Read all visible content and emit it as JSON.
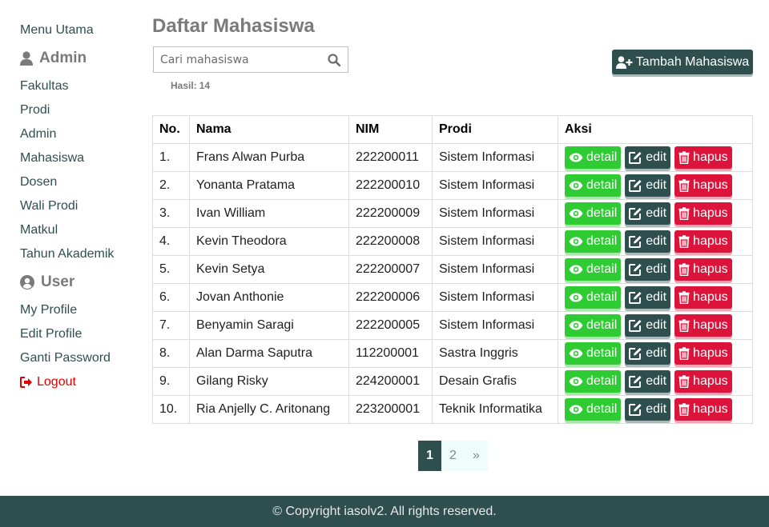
{
  "sidebar": {
    "menu_utama": "Menu Utama",
    "admin_section": {
      "title": "Admin",
      "items": [
        "Fakultas",
        "Prodi",
        "Admin",
        "Mahasiswa",
        "Dosen",
        "Wali Prodi",
        "Matkul",
        "Tahun Akademik"
      ]
    },
    "user_section": {
      "title": "User",
      "items": [
        "My Profile",
        "Edit Profile",
        "Ganti Password"
      ]
    },
    "logout": "Logout"
  },
  "main": {
    "title": "Daftar Mahasiswa",
    "search": {
      "placeholder": "Cari mahasiswa",
      "value": ""
    },
    "result": {
      "label": "Hasil:",
      "count": "14"
    },
    "add_button": "Tambah Mahasiswa"
  },
  "table": {
    "headers": [
      "No.",
      "Nama",
      "NIM",
      "Prodi",
      "Aksi"
    ],
    "action_labels": {
      "detail": "detail",
      "edit": "edit",
      "hapus": "hapus"
    },
    "rows": [
      {
        "no": "1.",
        "nama": "Frans Alwan Purba",
        "nim": "222200011",
        "prodi": "Sistem Informasi"
      },
      {
        "no": "2.",
        "nama": "Yonanta Pratama",
        "nim": "222200010",
        "prodi": "Sistem Informasi"
      },
      {
        "no": "3.",
        "nama": "Ivan William",
        "nim": "222200009",
        "prodi": "Sistem Informasi"
      },
      {
        "no": "4.",
        "nama": "Kevin Theodora",
        "nim": "222200008",
        "prodi": "Sistem Informasi"
      },
      {
        "no": "5.",
        "nama": "Kevin Setya",
        "nim": "222200007",
        "prodi": "Sistem Informasi"
      },
      {
        "no": "6.",
        "nama": "Jovan Anthonie",
        "nim": "222200006",
        "prodi": "Sistem Informasi"
      },
      {
        "no": "7.",
        "nama": "Benyamin Saragi",
        "nim": "222200005",
        "prodi": "Sistem Informasi"
      },
      {
        "no": "8.",
        "nama": "Alan Darma Saputra",
        "nim": "112200001",
        "prodi": "Sastra Inggris"
      },
      {
        "no": "9.",
        "nama": "Gilang Risky",
        "nim": "224200001",
        "prodi": "Desain Grafis"
      },
      {
        "no": "10.",
        "nama": "Ria Anjelly C. Aritonang",
        "nim": "223200001",
        "prodi": "Teknik Informatika"
      }
    ]
  },
  "pagination": {
    "pages": [
      "1",
      "2"
    ],
    "current": "1",
    "next": "»"
  },
  "footer": {
    "text": "© Copyright iasolv2. All rights reserved."
  },
  "colors": {
    "primary": "#2f4f4f",
    "detail": "#2ecc32",
    "hapus": "#dc143c",
    "logout": "#e10000",
    "muted": "#7a7a7a"
  },
  "icons": {
    "admin": "user-icon",
    "user": "user-circle-icon",
    "logout": "sign-out-icon",
    "search": "search-icon",
    "add": "user-plus-icon",
    "detail": "eye-icon",
    "edit": "pencil-square-icon",
    "hapus": "trash-icon"
  }
}
